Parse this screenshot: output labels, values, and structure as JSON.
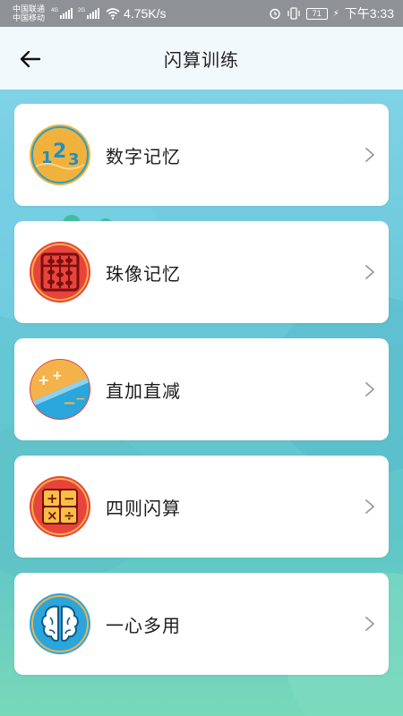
{
  "status_bar": {
    "carrier_1": "中国联通",
    "carrier_2": "中国移动",
    "net_1": "4G",
    "net_2": "2G",
    "speed": "4.75K/s",
    "battery": "71",
    "time": "下午3:33"
  },
  "header": {
    "title": "闪算训练"
  },
  "menu": {
    "items": [
      {
        "label": "数字记忆",
        "icon": "numbers-123-icon"
      },
      {
        "label": "珠像记忆",
        "icon": "abacus-icon"
      },
      {
        "label": "直加直减",
        "icon": "plus-minus-icon"
      },
      {
        "label": "四则闪算",
        "icon": "four-operations-icon"
      },
      {
        "label": "一心多用",
        "icon": "brain-icon"
      }
    ]
  },
  "icon_labels": {
    "digits": [
      "1",
      "2",
      "3"
    ],
    "ops": [
      "+",
      "−",
      "×",
      "÷"
    ]
  },
  "colors": {
    "background": "#6fcfd6",
    "header": "#f2f9fc",
    "status_bar": "#8e9297",
    "chevron": "#9a9a9a"
  }
}
